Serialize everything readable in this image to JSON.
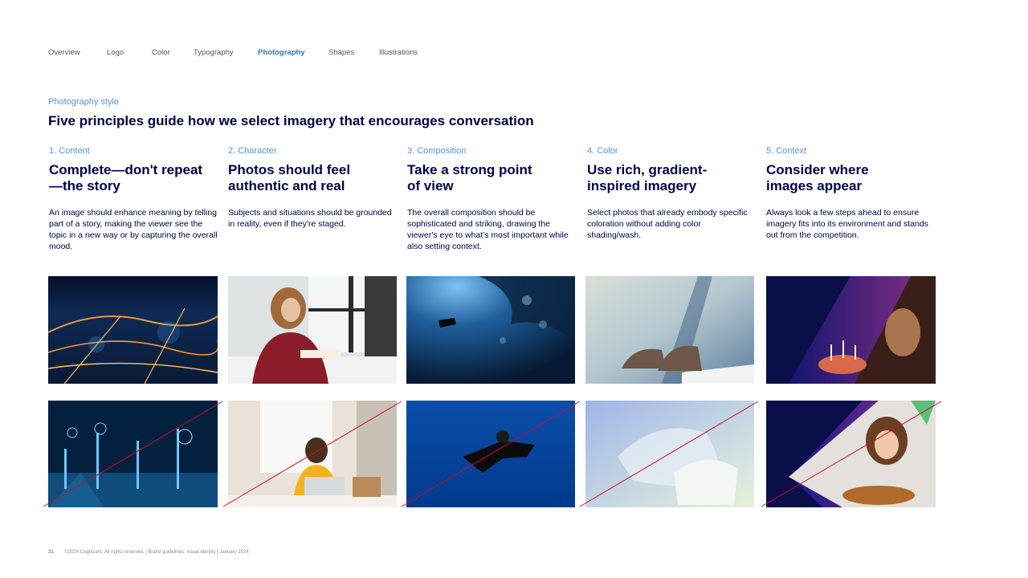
{
  "nav": {
    "items": [
      "Overview",
      "Logo",
      "Color",
      "Typography",
      "Photography",
      "Shapes",
      "Illustrations"
    ],
    "active_index": 4
  },
  "section": {
    "eyebrow": "Photography style",
    "headline": "Five principles guide how we select imagery that encourages conversation"
  },
  "principles": [
    {
      "number": "1. Content",
      "title": "Complete—don't repeat\n—the story",
      "body": "An image should enhance meaning by telling part of a story, making the viewer see the topic in a new way or by capturing the overall mood."
    },
    {
      "number": "2. Character",
      "title": "Photos should feel\nauthentic and real",
      "body": "Subjects and situations should be grounded in reality, even if they're staged."
    },
    {
      "number": "3. Composition",
      "title": "Take a strong point\nof view",
      "body": "The overall composition should be sophisticated and striking, drawing the viewer's eye to what's most important while also setting context."
    },
    {
      "number": "4. Color",
      "title": "Use rich, gradient-\ninspired imagery",
      "body": "Select photos that already embody specific coloration without adding color shading/wash."
    },
    {
      "number": "5. Context",
      "title": "Consider where\nimages appear",
      "body": "Always look a few steps ahead to ensure imagery fits into its environment and stands out from the competition."
    }
  ],
  "colors": {
    "navy": "#000048",
    "accent_blue": "#2f78c4",
    "light_blue": "#5b8fd6",
    "strike_red": "#c8102e",
    "gradient_purple": "#7b2d8e"
  },
  "footer": {
    "page_number": "31",
    "text": "©2024 Cognizant. All rights reserved.  |  Brand guidelines: visual identity  |  January 2024"
  }
}
